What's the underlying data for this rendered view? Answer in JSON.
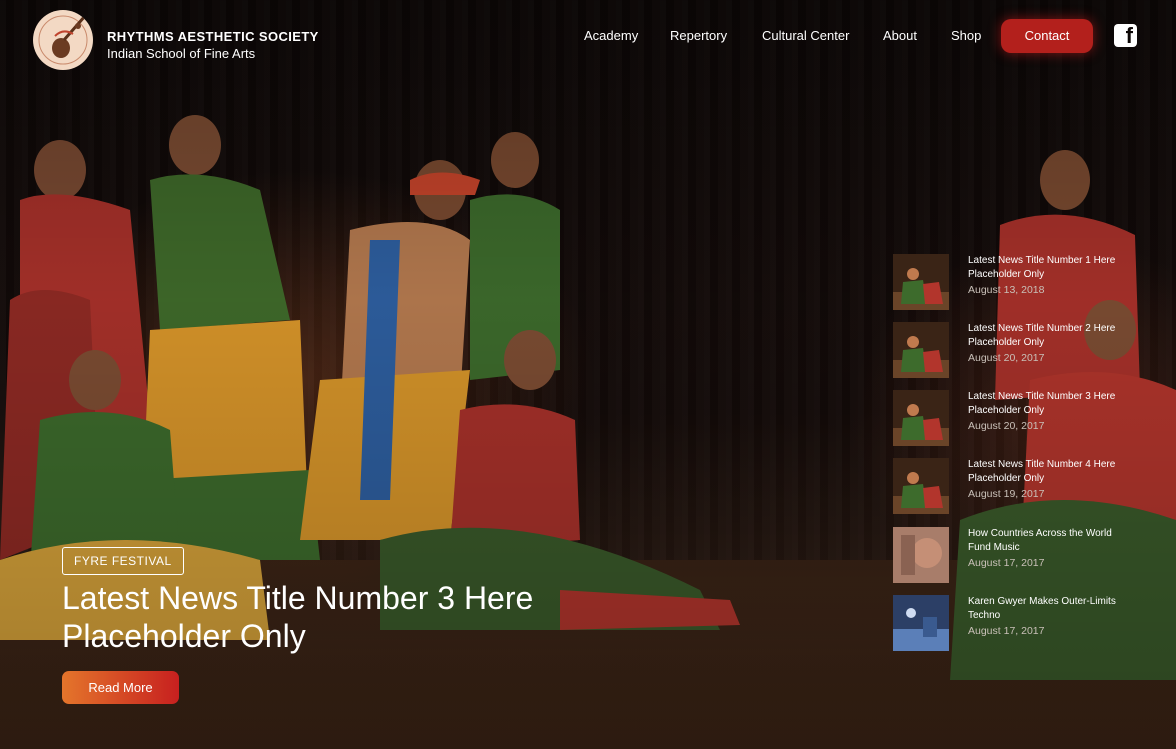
{
  "brand": {
    "name": "RHYTHMS AESTHETIC SOCIETY",
    "subtitle": "Indian School of Fine Arts"
  },
  "nav": {
    "items": [
      "Academy",
      "Repertory",
      "Cultural Center",
      "About",
      "Shop"
    ],
    "contact_label": "Contact",
    "social_icon": "facebook-icon"
  },
  "hero": {
    "tag": "FYRE FESTIVAL",
    "title_line1": "Latest News Title Number 3 Here",
    "title_line2": "Placeholder Only",
    "cta_label": "Read More"
  },
  "news": [
    {
      "title_line1": "Latest News Title Number 1 Here",
      "title_line2": "Placeholder Only",
      "date": "August 13, 2018",
      "thumb": "dancers"
    },
    {
      "title_line1": "Latest News Title Number 2 Here",
      "title_line2": "Placeholder Only",
      "date": "August 20, 2017",
      "thumb": "dancers"
    },
    {
      "title_line1": "Latest News Title Number 3 Here",
      "title_line2": "Placeholder Only",
      "date": "August 20, 2017",
      "thumb": "dancers"
    },
    {
      "title_line1": "Latest News Title Number 4 Here",
      "title_line2": "Placeholder Only",
      "date": "August 19, 2017",
      "thumb": "dancers"
    },
    {
      "title_line1": "How Countries Across the World",
      "title_line2": "Fund Music",
      "date": "August 17, 2017",
      "thumb": "portrait"
    },
    {
      "title_line1": "Karen Gwyer Makes Outer-Limits",
      "title_line2": "Techno",
      "date": "August 17, 2017",
      "thumb": "stage"
    }
  ],
  "colors": {
    "accent": "#b3201c",
    "cta_gradient_start": "#e4752b",
    "cta_gradient_end": "#c7201f"
  }
}
